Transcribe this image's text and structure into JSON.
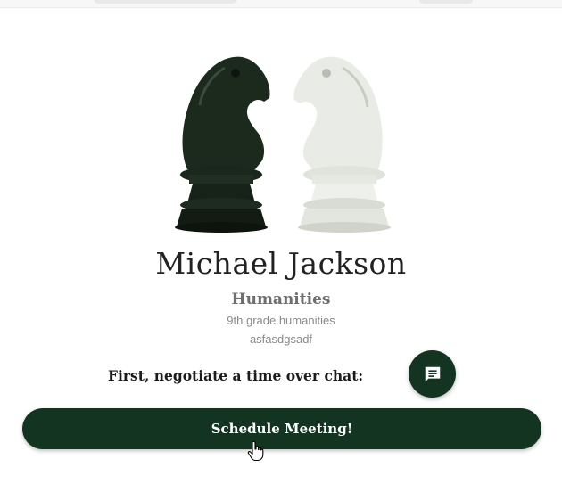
{
  "profile": {
    "name": "Michael Jackson",
    "subject": "Humanities",
    "description_line1": "9th grade humanities",
    "description_line2": "asfasdgsadf",
    "image_icon": "chess-knights-image"
  },
  "chat": {
    "prompt": "First, negotiate a time over chat:",
    "button_icon": "chat-message-icon"
  },
  "actions": {
    "schedule_label": "Schedule Meeting!"
  },
  "colors": {
    "primary": "#123420",
    "name_text": "#222222",
    "subject_text": "#6f6f6f",
    "description_text": "#8a8a8a"
  }
}
